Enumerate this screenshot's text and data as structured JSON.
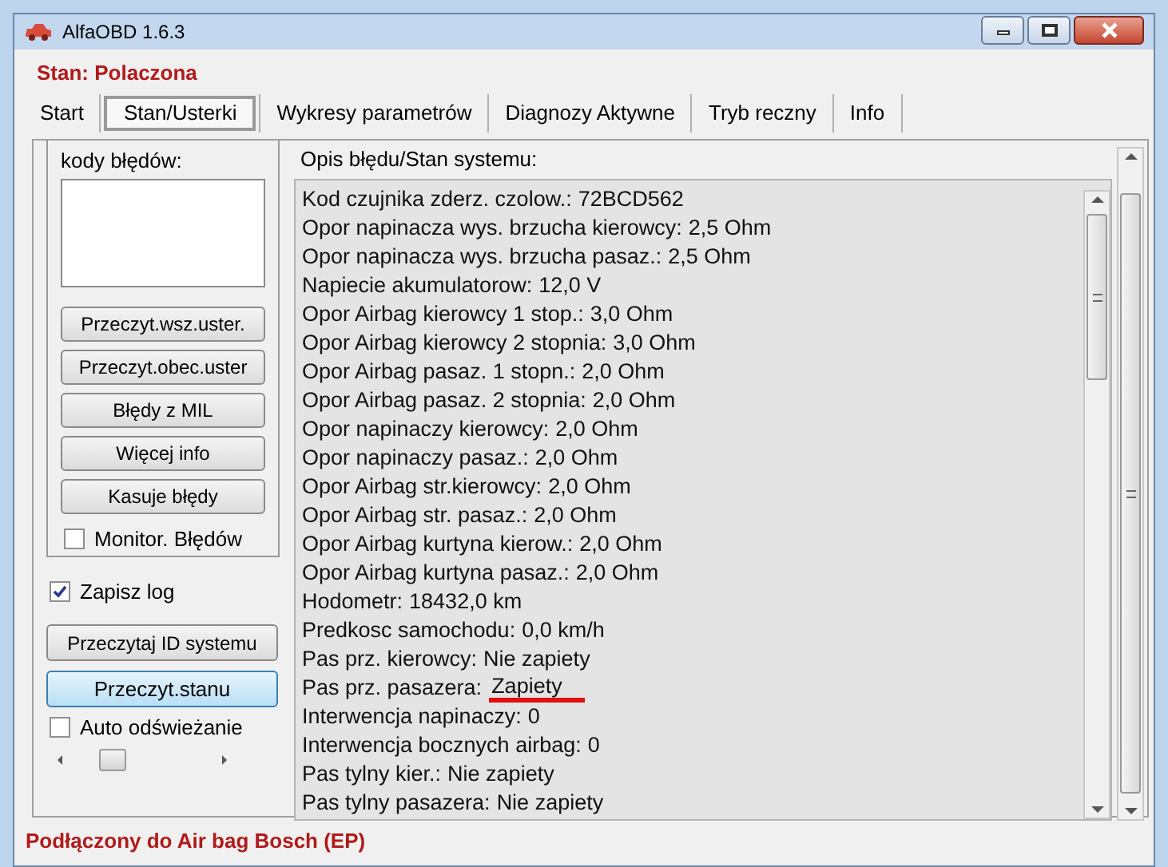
{
  "window": {
    "title": "AlfaOBD 1.6.3"
  },
  "connection_state": "Stan: Polaczona",
  "tabs": [
    {
      "label": "Start",
      "selected": false
    },
    {
      "label": "Stan/Usterki",
      "selected": true
    },
    {
      "label": "Wykresy parametrów",
      "selected": false
    },
    {
      "label": "Diagnozy Aktywne",
      "selected": false
    },
    {
      "label": "Tryb reczny",
      "selected": false
    },
    {
      "label": "Info",
      "selected": false
    }
  ],
  "fault_group": {
    "label": "kody błędów:",
    "buttons": [
      "Przeczyt.wsz.uster.",
      "Przeczyt.obec.uster",
      "Błędy z MIL",
      "Więcej info",
      "Kasuje błędy"
    ],
    "monitor": {
      "label": "Monitor. Błędów",
      "checked": false
    }
  },
  "save_log": {
    "label": "Zapisz log",
    "checked": true
  },
  "read_id_button": "Przeczytaj ID systemu",
  "read_state_button": {
    "label": "Przeczyt.stanu",
    "selected": true
  },
  "auto_refresh": {
    "label": "Auto odświeżanie",
    "checked": false
  },
  "status_panel": {
    "title": "Opis błędu/Stan systemu:",
    "lines": [
      {
        "label": "Kod czujnika zderz. czolow.:",
        "value": "72BCD562",
        "underlined": false
      },
      {
        "label": "Opor napinacza wys. brzucha kierowcy:",
        "value": "2,5 Ohm",
        "underlined": false
      },
      {
        "label": "Opor napinacza wys. brzucha pasaz.:",
        "value": "2,5 Ohm",
        "underlined": false
      },
      {
        "label": "Napiecie akumulatorow:",
        "value": "12,0 V",
        "underlined": false
      },
      {
        "label": "Opor Airbag kierowcy 1 stop.:",
        "value": "3,0 Ohm",
        "underlined": false
      },
      {
        "label": "Opor Airbag kierowcy 2 stopnia:",
        "value": "3,0 Ohm",
        "underlined": false
      },
      {
        "label": "Opor Airbag pasaz. 1 stopn.:",
        "value": "2,0 Ohm",
        "underlined": false
      },
      {
        "label": "Opor Airbag pasaz. 2 stopnia:",
        "value": "2,0 Ohm",
        "underlined": false
      },
      {
        "label": "Opor napinaczy kierowcy:",
        "value": "2,0 Ohm",
        "underlined": false
      },
      {
        "label": "Opor napinaczy pasaz.:",
        "value": "2,0 Ohm",
        "underlined": false
      },
      {
        "label": "Opor Airbag str.kierowcy:",
        "value": "2,0 Ohm",
        "underlined": false
      },
      {
        "label": "Opor Airbag str. pasaz.:",
        "value": "2,0 Ohm",
        "underlined": false
      },
      {
        "label": "Opor Airbag kurtyna kierow.:",
        "value": "2,0 Ohm",
        "underlined": false
      },
      {
        "label": "Opor Airbag kurtyna pasaz.:",
        "value": "2,0 Ohm",
        "underlined": false
      },
      {
        "label": "Hodometr:",
        "value": "18432,0 km",
        "underlined": false
      },
      {
        "label": "Predkosc samochodu:",
        "value": "0,0 km/h",
        "underlined": false
      },
      {
        "label": "Pas prz. kierowcy:",
        "value": "Nie zapiety",
        "underlined": false
      },
      {
        "label": "Pas prz. pasazera:",
        "value": "Zapiety",
        "underlined": true
      },
      {
        "label": "Interwencja napinaczy:",
        "value": "0",
        "underlined": false
      },
      {
        "label": "Interwencja bocznych airbag:",
        "value": "0",
        "underlined": false
      },
      {
        "label": "Pas tylny kier.:",
        "value": "Nie zapiety",
        "underlined": false
      },
      {
        "label": "Pas tylny pasazera:",
        "value": "Nie zapiety",
        "underlined": false
      }
    ]
  },
  "status_bar": "Podłączony do Air bag Bosch (EP)"
}
